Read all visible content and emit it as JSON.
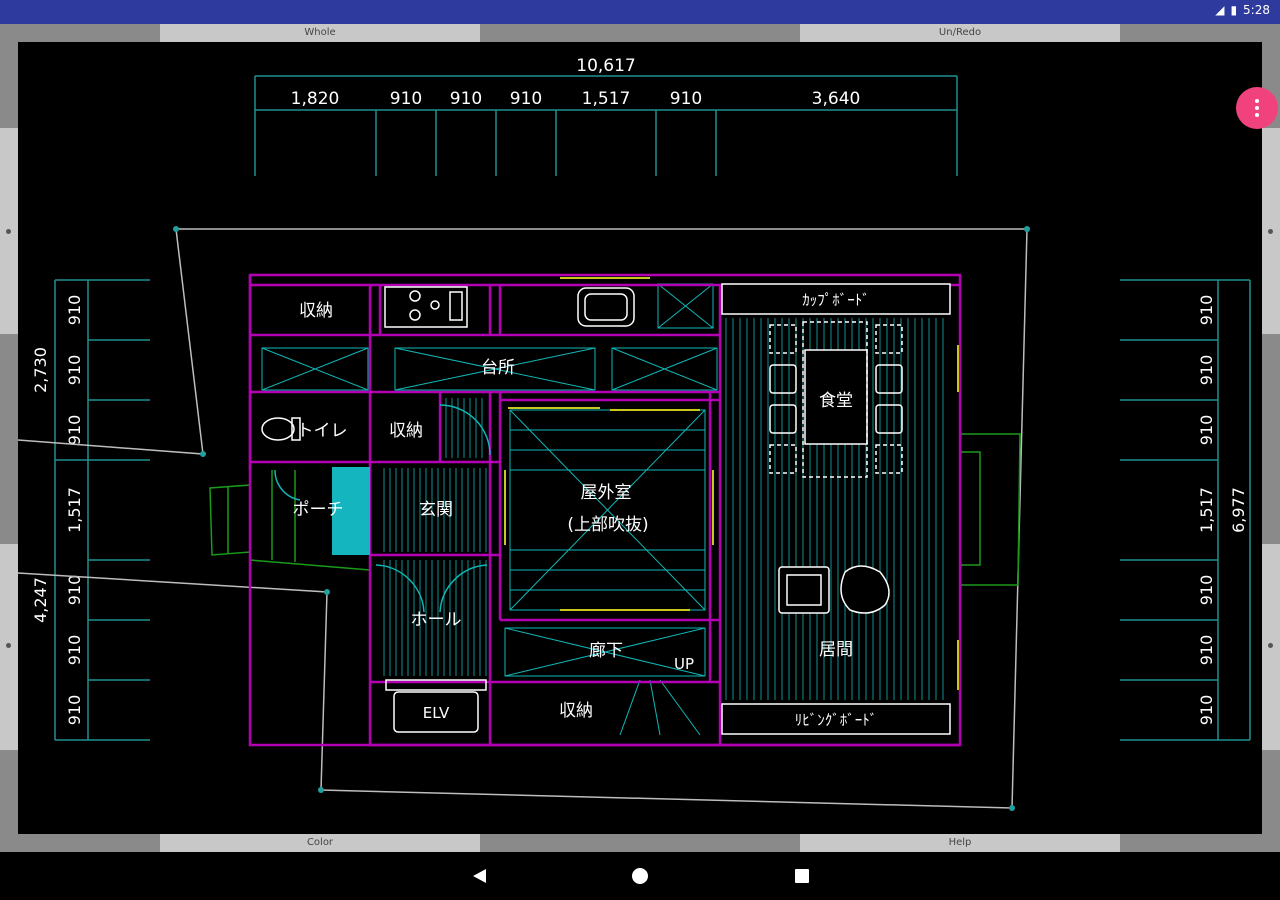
{
  "status_bar": {
    "time": "5:28"
  },
  "toolbar": {
    "top_left": "Whole",
    "top_right": "Un/Redo",
    "bottom_left": "Color",
    "bottom_right": "Help"
  },
  "dimensions": {
    "top_total": "10,617",
    "top_segments": [
      "1,820",
      "910",
      "910",
      "910",
      "1,517",
      "910",
      "3,640"
    ],
    "left_upper_total": "2,730",
    "left_lower_total": "4,247",
    "left_segments": [
      "910",
      "910",
      "910",
      "1,517",
      "910",
      "910",
      "910"
    ],
    "right_total": "6,977",
    "right_segments": [
      "910",
      "910",
      "910",
      "1,517",
      "910",
      "910",
      "910"
    ]
  },
  "rooms": {
    "storage_top": "収納",
    "kitchen": "台所",
    "cupboard": "ｶｯﾌﾟﾎﾞｰﾄﾞ",
    "dining": "食堂",
    "toilet": "トイレ",
    "storage_mid": "収納",
    "porch": "ポーチ",
    "entrance": "玄関",
    "courtyard": "屋外室",
    "courtyard_sub": "(上部吹抜)",
    "hall": "ホール",
    "corridor": "廊下",
    "stairs_up": "UP",
    "living": "居間",
    "elevator": "ELV",
    "storage_bottom": "収納",
    "living_board": "ﾘﾋﾞﾝｸﾞﾎﾞｰﾄﾞ"
  },
  "colors": {
    "canvas": "#000000",
    "dimension_line": "#1f8f8f",
    "wall": "#b400b4",
    "room_line": "#11b7b7",
    "site_line": "#bdbdbd",
    "accent": "#f0437e",
    "porch_fill": "#15b5c0"
  },
  "icons": {
    "menu": "more-vert-icon",
    "back": "nav-back-icon",
    "home": "nav-home-icon",
    "recents": "nav-recents-icon"
  }
}
